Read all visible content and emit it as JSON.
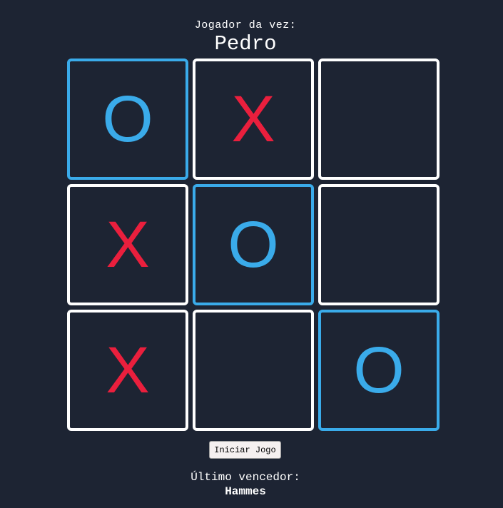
{
  "turn": {
    "label": "Jogador da vez:",
    "player": "Pedro"
  },
  "board": {
    "cells": [
      {
        "mark": "O",
        "winning": true
      },
      {
        "mark": "X",
        "winning": false
      },
      {
        "mark": "",
        "winning": false
      },
      {
        "mark": "X",
        "winning": false
      },
      {
        "mark": "O",
        "winning": true
      },
      {
        "mark": "",
        "winning": false
      },
      {
        "mark": "X",
        "winning": false
      },
      {
        "mark": "",
        "winning": false
      },
      {
        "mark": "O",
        "winning": true
      }
    ]
  },
  "colors": {
    "background": "#1d2433",
    "x_mark": "#ea1f3d",
    "o_mark": "#3aabea",
    "cell_border": "#ffffff",
    "winning_border": "#3aabea"
  },
  "controls": {
    "start_label": "Iniciar Jogo"
  },
  "last_winner": {
    "label": "Último vencedor:",
    "name": "Hammes"
  }
}
